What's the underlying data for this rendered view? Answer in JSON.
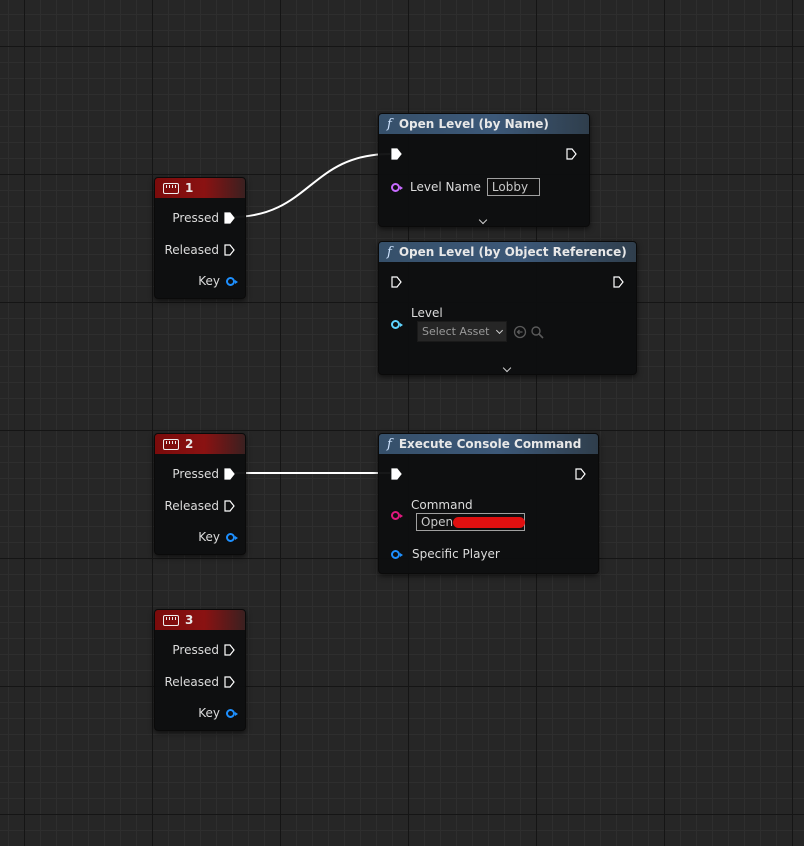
{
  "colors": {
    "key_header": "#7a0b0b",
    "function_header": "#36506a",
    "wire": "#ffffff",
    "string_pin": "#c76bff",
    "object_pin": "#1e90ff",
    "level_pin": "#5fd4ff",
    "command_pin": "#e0187e",
    "redaction": "#e01010"
  },
  "key_nodes": [
    {
      "title": "1",
      "pins": {
        "pressed": "Pressed",
        "released": "Released",
        "key": "Key"
      }
    },
    {
      "title": "2",
      "pins": {
        "pressed": "Pressed",
        "released": "Released",
        "key": "Key"
      }
    },
    {
      "title": "3",
      "pins": {
        "pressed": "Pressed",
        "released": "Released",
        "key": "Key"
      }
    }
  ],
  "open_level_by_name": {
    "icon": "function-icon",
    "title": "Open Level (by Name)",
    "level_name_label": "Level Name",
    "level_name_value": "Lobby"
  },
  "open_level_by_ref": {
    "icon": "function-icon",
    "title": "Open Level (by Object Reference)",
    "level_label": "Level",
    "asset_dropdown": "Select Asset"
  },
  "execute_console_command": {
    "icon": "function-icon",
    "title": "Execute Console Command",
    "command_label": "Command",
    "command_value": "Open",
    "specific_player_label": "Specific Player"
  }
}
